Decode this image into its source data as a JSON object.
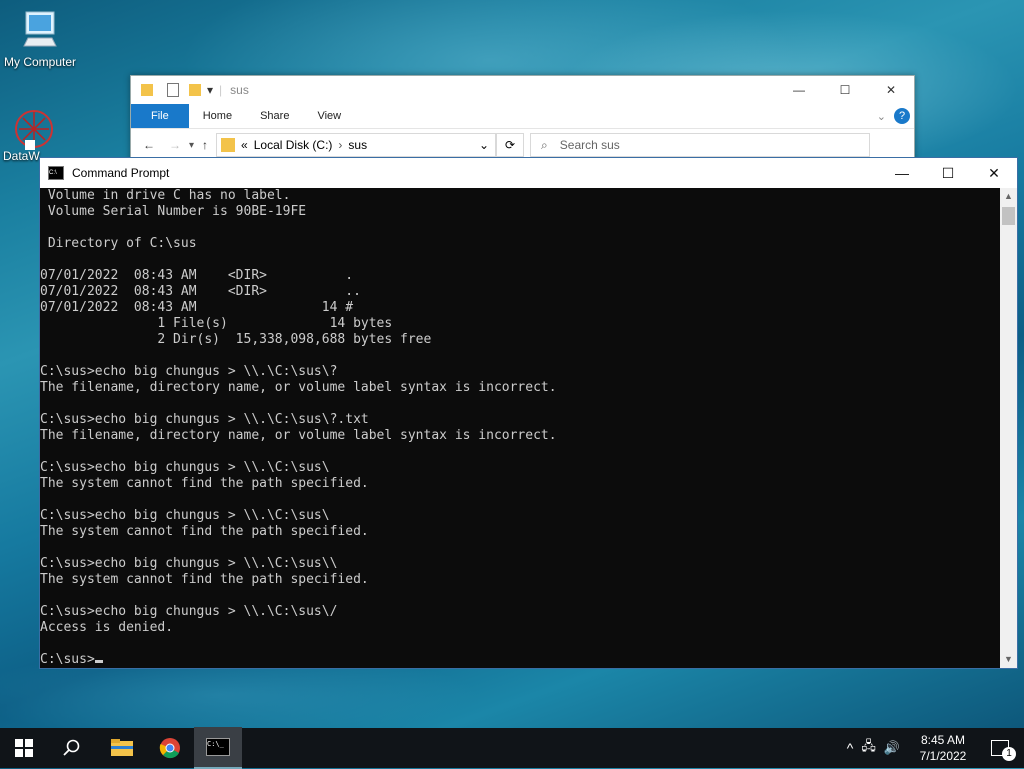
{
  "desktop": {
    "icons": [
      {
        "label": "My Computer"
      },
      {
        "label": "DataW"
      }
    ]
  },
  "explorer": {
    "title": "sus",
    "tabs": [
      "File",
      "Home",
      "Share",
      "View"
    ],
    "breadcrumb": [
      "Local Disk (C:)",
      "sus"
    ],
    "breadcrumb_prefix": "«",
    "search_placeholder": "Search sus"
  },
  "cmd": {
    "title": "Command Prompt",
    "lines": [
      " Volume in drive C has no label.",
      " Volume Serial Number is 90BE-19FE",
      "",
      " Directory of C:\\sus",
      "",
      "07/01/2022  08:43 AM    <DIR>          .",
      "07/01/2022  08:43 AM    <DIR>          ..",
      "07/01/2022  08:43 AM                14 #",
      "               1 File(s)             14 bytes",
      "               2 Dir(s)  15,338,098,688 bytes free",
      "",
      "C:\\sus>echo big chungus > \\\\.\\C:\\sus\\?",
      "The filename, directory name, or volume label syntax is incorrect.",
      "",
      "C:\\sus>echo big chungus > \\\\.\\C:\\sus\\?.txt",
      "The filename, directory name, or volume label syntax is incorrect.",
      "",
      "C:\\sus>echo big chungus > \\\\.\\C:\\sus\\",
      "The system cannot find the path specified.",
      "",
      "C:\\sus>echo big chungus > \\\\.\\C:\\sus\\",
      "The system cannot find the path specified.",
      "",
      "C:\\sus>echo big chungus > \\\\.\\C:\\sus\\\\",
      "The system cannot find the path specified.",
      "",
      "C:\\sus>echo big chungus > \\\\.\\C:\\sus\\/",
      "Access is denied.",
      ""
    ],
    "prompt": "C:\\sus>"
  },
  "taskbar": {
    "time": "8:45 AM",
    "date": "7/1/2022",
    "notification_count": "1"
  },
  "colors": {
    "console_bg": "#0c0c0c",
    "console_fg": "#cccccc",
    "accent": "#1979ca",
    "taskbar": "#101418"
  },
  "icons": [
    "start-icon",
    "search-icon",
    "file-explorer-icon",
    "chrome-icon",
    "cmd-icon",
    "chevron-up-icon",
    "network-icon",
    "volume-icon",
    "notification-icon"
  ]
}
